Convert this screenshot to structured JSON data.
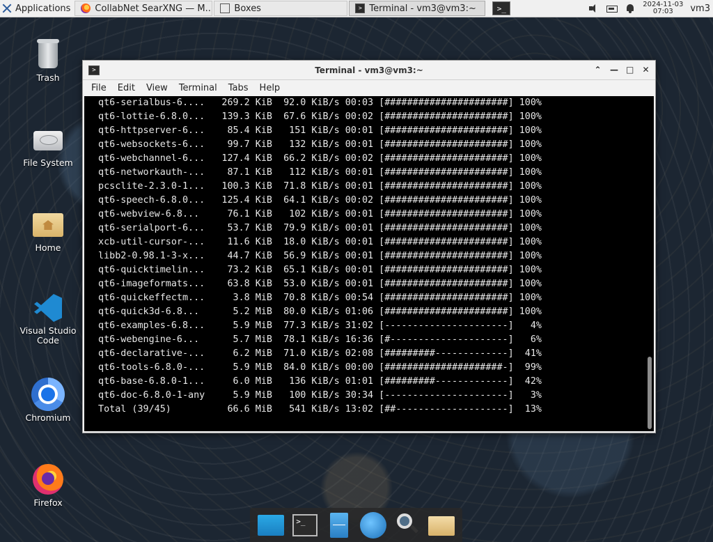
{
  "top_panel": {
    "applications_label": "Applications",
    "tasks": [
      {
        "label": "CollabNet SearXNG — M...",
        "icon": "firefox-icon"
      },
      {
        "label": "Boxes",
        "icon": "boxes-icon"
      },
      {
        "label": "Terminal - vm3@vm3:~",
        "icon": "terminal-icon"
      }
    ],
    "clock_date": "2024-11-03",
    "clock_time": "07:03",
    "user": "vm3"
  },
  "desktop_icons": [
    {
      "label": "Trash",
      "icon": "trash-icon"
    },
    {
      "label": "File System",
      "icon": "drive-icon"
    },
    {
      "label": "Home",
      "icon": "home-folder-icon"
    },
    {
      "label": "Visual Studio Code",
      "icon": "vscode-icon"
    },
    {
      "label": "Chromium",
      "icon": "chromium-icon"
    },
    {
      "label": "Firefox",
      "icon": "firefox-icon"
    }
  ],
  "terminal": {
    "title": "Terminal - vm3@vm3:~",
    "menu": [
      "File",
      "Edit",
      "View",
      "Terminal",
      "Tabs",
      "Help"
    ],
    "lines": [
      " qt6-serialbus-6....   269.2 KiB  92.0 KiB/s 00:03 [######################] 100%",
      " qt6-lottie-6.8.0...   139.3 KiB  67.6 KiB/s 00:02 [######################] 100%",
      " qt6-httpserver-6...    85.4 KiB   151 KiB/s 00:01 [######################] 100%",
      " qt6-websockets-6...    99.7 KiB   132 KiB/s 00:01 [######################] 100%",
      " qt6-webchannel-6...   127.4 KiB  66.2 KiB/s 00:02 [######################] 100%",
      " qt6-networkauth-...    87.1 KiB   112 KiB/s 00:01 [######################] 100%",
      " pcsclite-2.3.0-1...   100.3 KiB  71.8 KiB/s 00:01 [######################] 100%",
      " qt6-speech-6.8.0...   125.4 KiB  64.1 KiB/s 00:02 [######################] 100%",
      " qt6-webview-6.8...     76.1 KiB   102 KiB/s 00:01 [######################] 100%",
      " qt6-serialport-6...    53.7 KiB  79.9 KiB/s 00:01 [######################] 100%",
      " xcb-util-cursor-...    11.6 KiB  18.0 KiB/s 00:01 [######################] 100%",
      " libb2-0.98.1-3-x...    44.7 KiB  56.9 KiB/s 00:01 [######################] 100%",
      " qt6-quicktimelin...    73.2 KiB  65.1 KiB/s 00:01 [######################] 100%",
      " qt6-imageformats...    63.8 KiB  53.0 KiB/s 00:01 [######################] 100%",
      " qt6-quickeffectm...     3.8 MiB  70.8 KiB/s 00:54 [######################] 100%",
      " qt6-quick3d-6.8...      5.2 MiB  80.0 KiB/s 01:06 [######################] 100%",
      " qt6-examples-6.8...     5.9 MiB  77.3 KiB/s 31:02 [----------------------]   4%",
      " qt6-webengine-6...      5.7 MiB  78.1 KiB/s 16:36 [#---------------------]   6%",
      " qt6-declarative-...     6.2 MiB  71.0 KiB/s 02:08 [#########-------------]  41%",
      " qt6-tools-6.8.0-...     5.9 MiB  84.0 KiB/s 00:00 [#####################-]  99%",
      " qt6-base-6.8.0-1...     6.0 MiB   136 KiB/s 01:01 [#########-------------]  42%",
      " qt6-doc-6.8.0-1-any     5.9 MiB   100 KiB/s 30:34 [----------------------]   3%",
      " Total (39/45)          66.6 MiB   541 KiB/s 13:02 [##--------------------]  13%"
    ]
  },
  "dock": [
    {
      "icon": "show-desktop-icon"
    },
    {
      "icon": "terminal-icon"
    },
    {
      "icon": "file-cabinet-icon"
    },
    {
      "icon": "web-browser-icon"
    },
    {
      "icon": "app-finder-icon"
    },
    {
      "icon": "folder-icon"
    }
  ]
}
